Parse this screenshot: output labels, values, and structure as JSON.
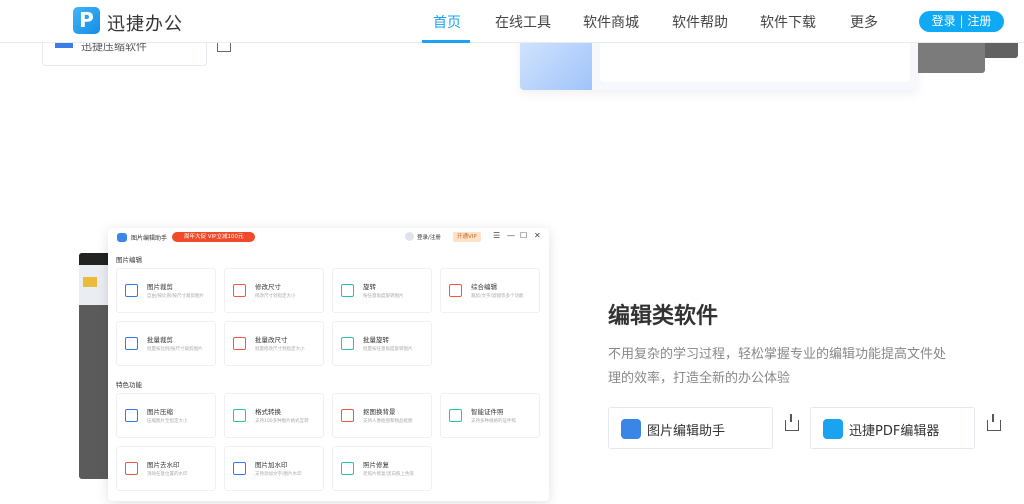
{
  "header": {
    "logo_text": "迅捷办公",
    "logo_glyph": "P",
    "nav": [
      {
        "label": "首页",
        "active": true
      },
      {
        "label": "在线工具"
      },
      {
        "label": "软件商城"
      },
      {
        "label": "软件帮助"
      },
      {
        "label": "软件下载"
      },
      {
        "label": "更多"
      }
    ],
    "login_label": "登录 | 注册"
  },
  "top_section": {
    "product_label": "迅捷压缩软件"
  },
  "app_screenshot": {
    "title": "图片编辑助手",
    "promo": "周年大促 VIP立减100元",
    "user": "登录/注册",
    "vip": "开通VIP",
    "controls": [
      "☰",
      "—",
      "☐",
      "✕"
    ],
    "sections": [
      {
        "label": "图片编辑",
        "items": [
          {
            "title": "图片裁剪",
            "desc": "自由/按比例/按尺寸裁剪图片",
            "color": "#2f7cf0"
          },
          {
            "title": "修改尺寸",
            "desc": "修改尺寸到指定大小",
            "color": "#f2583e"
          },
          {
            "title": "旋转",
            "desc": "按任意角度旋转图片",
            "color": "#22c3b8"
          },
          {
            "title": "综合编辑",
            "desc": "裁剪/文字/滤镜等多个功能",
            "color": "#f2583e"
          },
          {
            "title": "批量裁剪",
            "desc": "批量按比例/按尺寸裁剪图片",
            "color": "#2f7cf0"
          },
          {
            "title": "批量改尺寸",
            "desc": "批量修改尺寸到指定大小",
            "color": "#f2583e"
          },
          {
            "title": "批量旋转",
            "desc": "批量按任意角度旋转图片",
            "color": "#22c3b8"
          }
        ]
      },
      {
        "label": "特色功能",
        "items": [
          {
            "title": "图片压缩",
            "desc": "压缩图片至指定大小",
            "color": "#2f7cf0"
          },
          {
            "title": "格式转换",
            "desc": "支持100多种图片格式互转",
            "color": "#22c3b8"
          },
          {
            "title": "抠图换背景",
            "desc": "支持人像抠图和物品抠图",
            "color": "#f2583e"
          },
          {
            "title": "智能证件照",
            "desc": "支持多种规格的证件照",
            "color": "#22c3b8"
          },
          {
            "title": "图片去水印",
            "desc": "消除任意位置的水印",
            "color": "#f2583e"
          },
          {
            "title": "图片加水印",
            "desc": "支持添加文字/图片水印",
            "color": "#2f7cf0"
          },
          {
            "title": "照片修复",
            "desc": "老照片修复/黑白照上色等",
            "color": "#22c3b8"
          }
        ]
      }
    ]
  },
  "feature": {
    "title": "编辑类软件",
    "desc_lines": [
      "不用复杂的学习过程，轻松掌握专业的编辑功能提高文件处",
      "理的效率，打造全新的办公体验"
    ],
    "products": [
      {
        "label": "图片编辑助手",
        "color": "#3a86e8"
      },
      {
        "label": "迅捷PDF编辑器",
        "color": "#1aa3f0"
      }
    ]
  }
}
